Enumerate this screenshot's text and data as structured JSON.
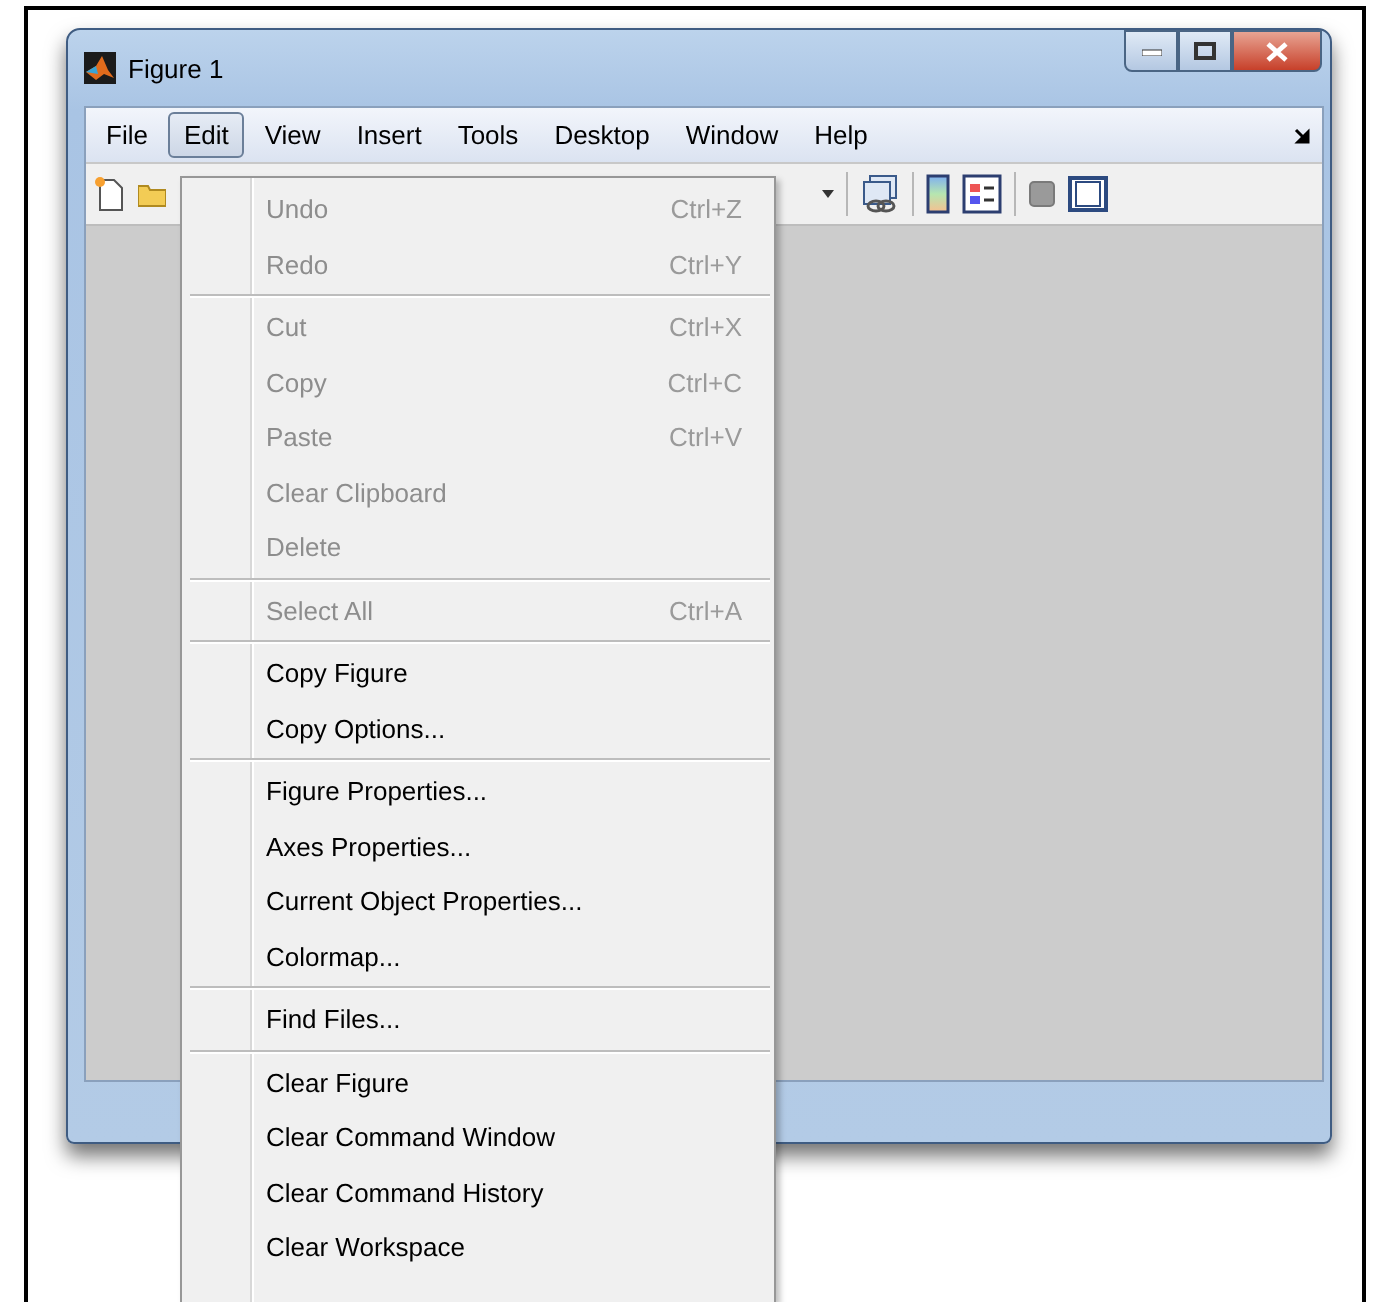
{
  "window": {
    "title": "Figure 1"
  },
  "menu_bar": [
    {
      "label": "File",
      "selected": false
    },
    {
      "label": "Edit",
      "selected": true
    },
    {
      "label": "View",
      "selected": false
    },
    {
      "label": "Insert",
      "selected": false
    },
    {
      "label": "Tools",
      "selected": false
    },
    {
      "label": "Desktop",
      "selected": false
    },
    {
      "label": "Window",
      "selected": false
    },
    {
      "label": "Help",
      "selected": false
    }
  ],
  "edit_menu": {
    "groups": [
      [
        {
          "label": "Undo",
          "shortcut": "Ctrl+Z",
          "disabled": true
        },
        {
          "label": "Redo",
          "shortcut": "Ctrl+Y",
          "disabled": true
        }
      ],
      [
        {
          "label": "Cut",
          "shortcut": "Ctrl+X",
          "disabled": true
        },
        {
          "label": "Copy",
          "shortcut": "Ctrl+C",
          "disabled": true
        },
        {
          "label": "Paste",
          "shortcut": "Ctrl+V",
          "disabled": true
        },
        {
          "label": "Clear Clipboard",
          "disabled": true
        },
        {
          "label": "Delete",
          "disabled": true
        }
      ],
      [
        {
          "label": "Select All",
          "shortcut": "Ctrl+A",
          "disabled": true
        }
      ],
      [
        {
          "label": "Copy Figure",
          "disabled": false
        },
        {
          "label": "Copy Options...",
          "disabled": false
        }
      ],
      [
        {
          "label": "Figure Properties...",
          "disabled": false
        },
        {
          "label": "Axes Properties...",
          "disabled": false
        },
        {
          "label": "Current Object Properties...",
          "disabled": false
        },
        {
          "label": "Colormap...",
          "disabled": false
        }
      ],
      [
        {
          "label": "Find Files...",
          "disabled": false
        }
      ],
      [
        {
          "label": "Clear Figure",
          "disabled": false
        },
        {
          "label": "Clear Command Window",
          "disabled": false
        },
        {
          "label": "Clear Command History",
          "disabled": false
        },
        {
          "label": "Clear Workspace",
          "disabled": false
        }
      ]
    ]
  }
}
